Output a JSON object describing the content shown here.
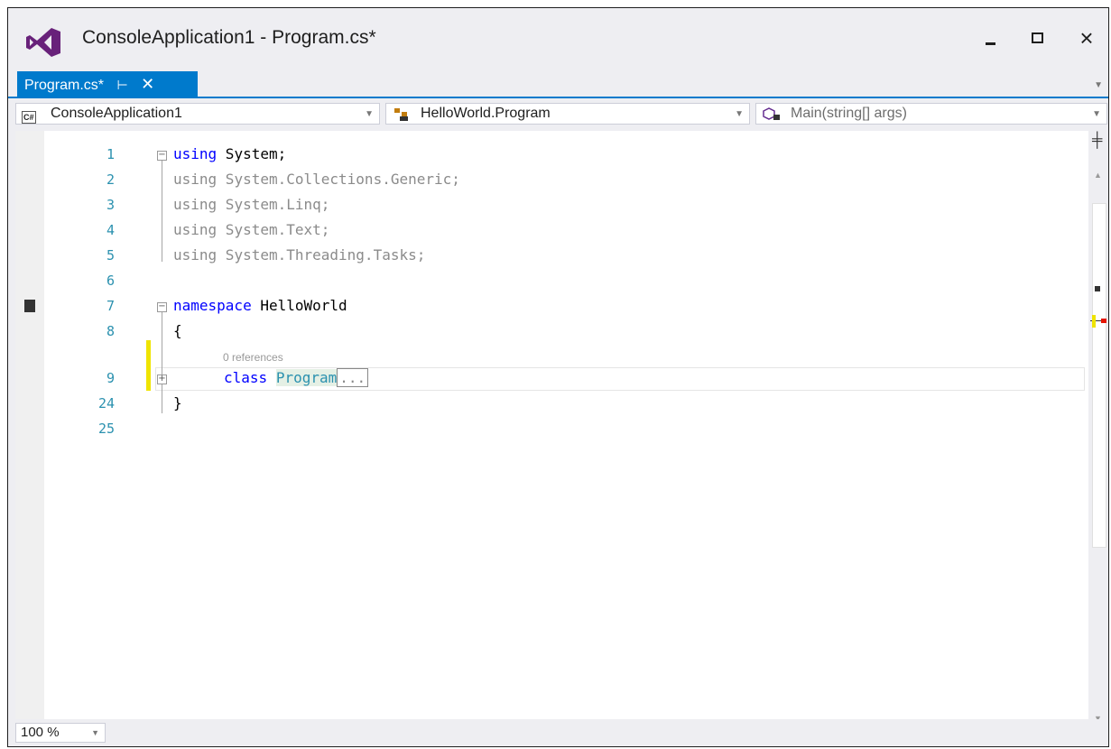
{
  "window": {
    "title": "ConsoleApplication1 - Program.cs*"
  },
  "tab": {
    "label": "Program.cs*",
    "pin": "⊢",
    "close": "✕"
  },
  "nav": {
    "project": "ConsoleApplication1",
    "class": "HelloWorld.Program",
    "member": "Main(string[] args)"
  },
  "code": {
    "line_numbers": [
      "1",
      "2",
      "3",
      "4",
      "5",
      "6",
      "7",
      "8",
      "9",
      "24",
      "25"
    ],
    "lines": [
      {
        "kw": "using",
        "rest": " System;"
      },
      {
        "kw": "using",
        "rest": " System.Collections.Generic;"
      },
      {
        "kw": "using",
        "rest": " System.Linq;"
      },
      {
        "kw": "using",
        "rest": " System.Text;"
      },
      {
        "kw": "using",
        "rest": " System.Threading.Tasks;"
      },
      {
        "kw": "",
        "rest": ""
      },
      {
        "kw": "namespace",
        "rest": " HelloWorld"
      },
      {
        "kw": "",
        "rest": "{"
      },
      {
        "kw": "class",
        "rest": " ",
        "type": "Program",
        "collapsed": "..."
      },
      {
        "kw": "",
        "rest": "}"
      },
      {
        "kw": "",
        "rest": ""
      }
    ],
    "codelens": "0 references"
  },
  "status": {
    "zoom": "100 %"
  }
}
